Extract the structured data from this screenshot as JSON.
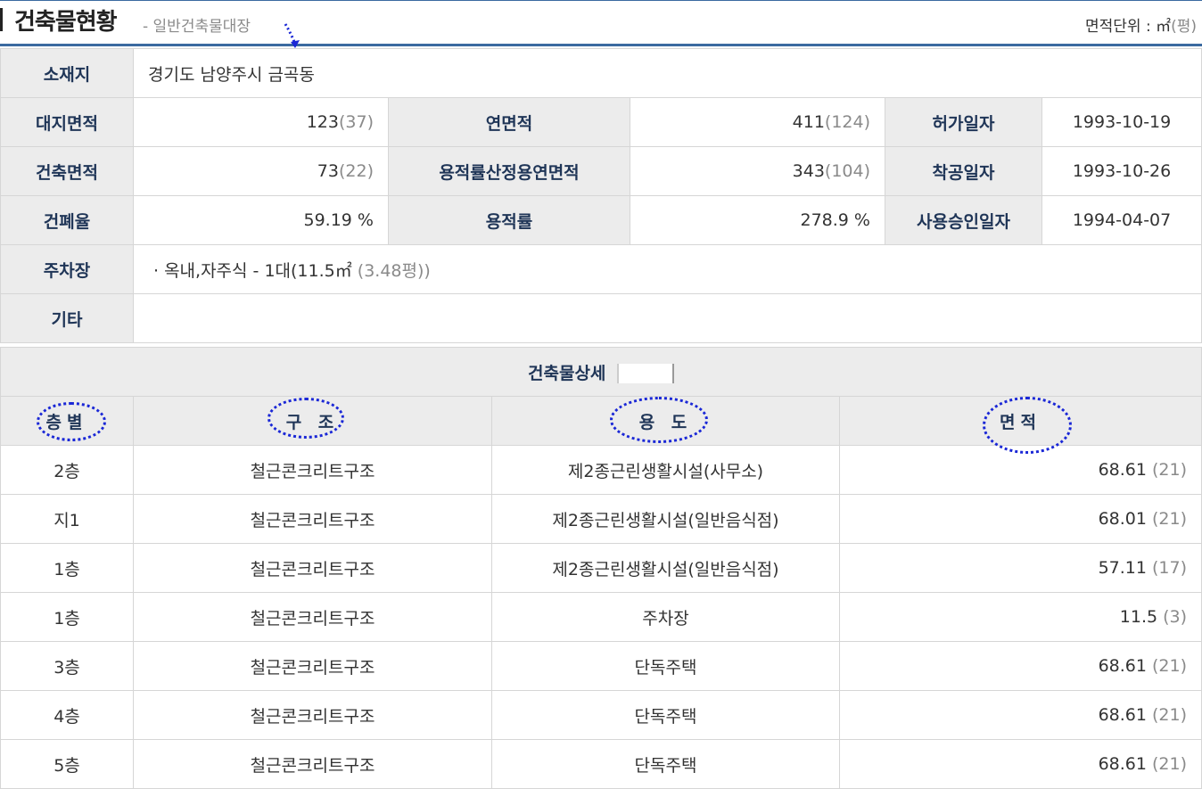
{
  "header": {
    "title": "건축물현황",
    "subtitle": "- 일반건축물대장",
    "unit_label": "면적단위 : ㎡",
    "unit_paren": "(평)"
  },
  "summary": {
    "location_label": "소재지",
    "location_value": "경기도 남양주시 금곡동",
    "site_area_label": "대지면적",
    "site_area_value": "123",
    "site_area_pyeong": "(37)",
    "total_floor_area_label": "연면적",
    "total_floor_area_value": "411",
    "total_floor_area_pyeong": "(124)",
    "permit_date_label": "허가일자",
    "permit_date_value": "1993-10-19",
    "building_area_label": "건축면적",
    "building_area_value": "73",
    "building_area_pyeong": "(22)",
    "far_floor_area_label": "용적률산정용연면적",
    "far_floor_area_value": "343",
    "far_floor_area_pyeong": "(104)",
    "start_date_label": "착공일자",
    "start_date_value": "1993-10-26",
    "coverage_label": "건폐율",
    "coverage_value": "59.19 %",
    "far_label": "용적률",
    "far_value": "278.9 %",
    "approval_date_label": "사용승인일자",
    "approval_date_value": "1994-04-07",
    "parking_label": "주차장",
    "parking_value": "· 옥내,자주식 - 1대(11.5㎡",
    "parking_pyeong": " (3.48평))",
    "etc_label": "기타",
    "etc_value": ""
  },
  "detail": {
    "title": "건축물상세",
    "title_bracket_open": "[",
    "title_bracket_close": "]",
    "columns": [
      "층별",
      "구 조",
      "용 도",
      "면적"
    ],
    "rows": [
      {
        "floor": "2층",
        "structure": "철근콘크리트구조",
        "use": "제2종근린생활시설(사무소)",
        "area": "68.61",
        "pyeong": " (21)"
      },
      {
        "floor": "지1",
        "structure": "철근콘크리트구조",
        "use": "제2종근린생활시설(일반음식점)",
        "area": "68.01",
        "pyeong": " (21)"
      },
      {
        "floor": "1층",
        "structure": "철근콘크리트구조",
        "use": "제2종근린생활시설(일반음식점)",
        "area": "57.11",
        "pyeong": " (17)"
      },
      {
        "floor": "1층",
        "structure": "철근콘크리트구조",
        "use": "주차장",
        "area": "11.5",
        "pyeong": " (3)"
      },
      {
        "floor": "3층",
        "structure": "철근콘크리트구조",
        "use": "단독주택",
        "area": "68.61",
        "pyeong": " (21)"
      },
      {
        "floor": "4층",
        "structure": "철근콘크리트구조",
        "use": "단독주택",
        "area": "68.61",
        "pyeong": " (21)"
      },
      {
        "floor": "5층",
        "structure": "철근콘크리트구조",
        "use": "단독주택",
        "area": "68.61",
        "pyeong": " (21)"
      }
    ]
  },
  "annotation_color": "#1a27d6"
}
